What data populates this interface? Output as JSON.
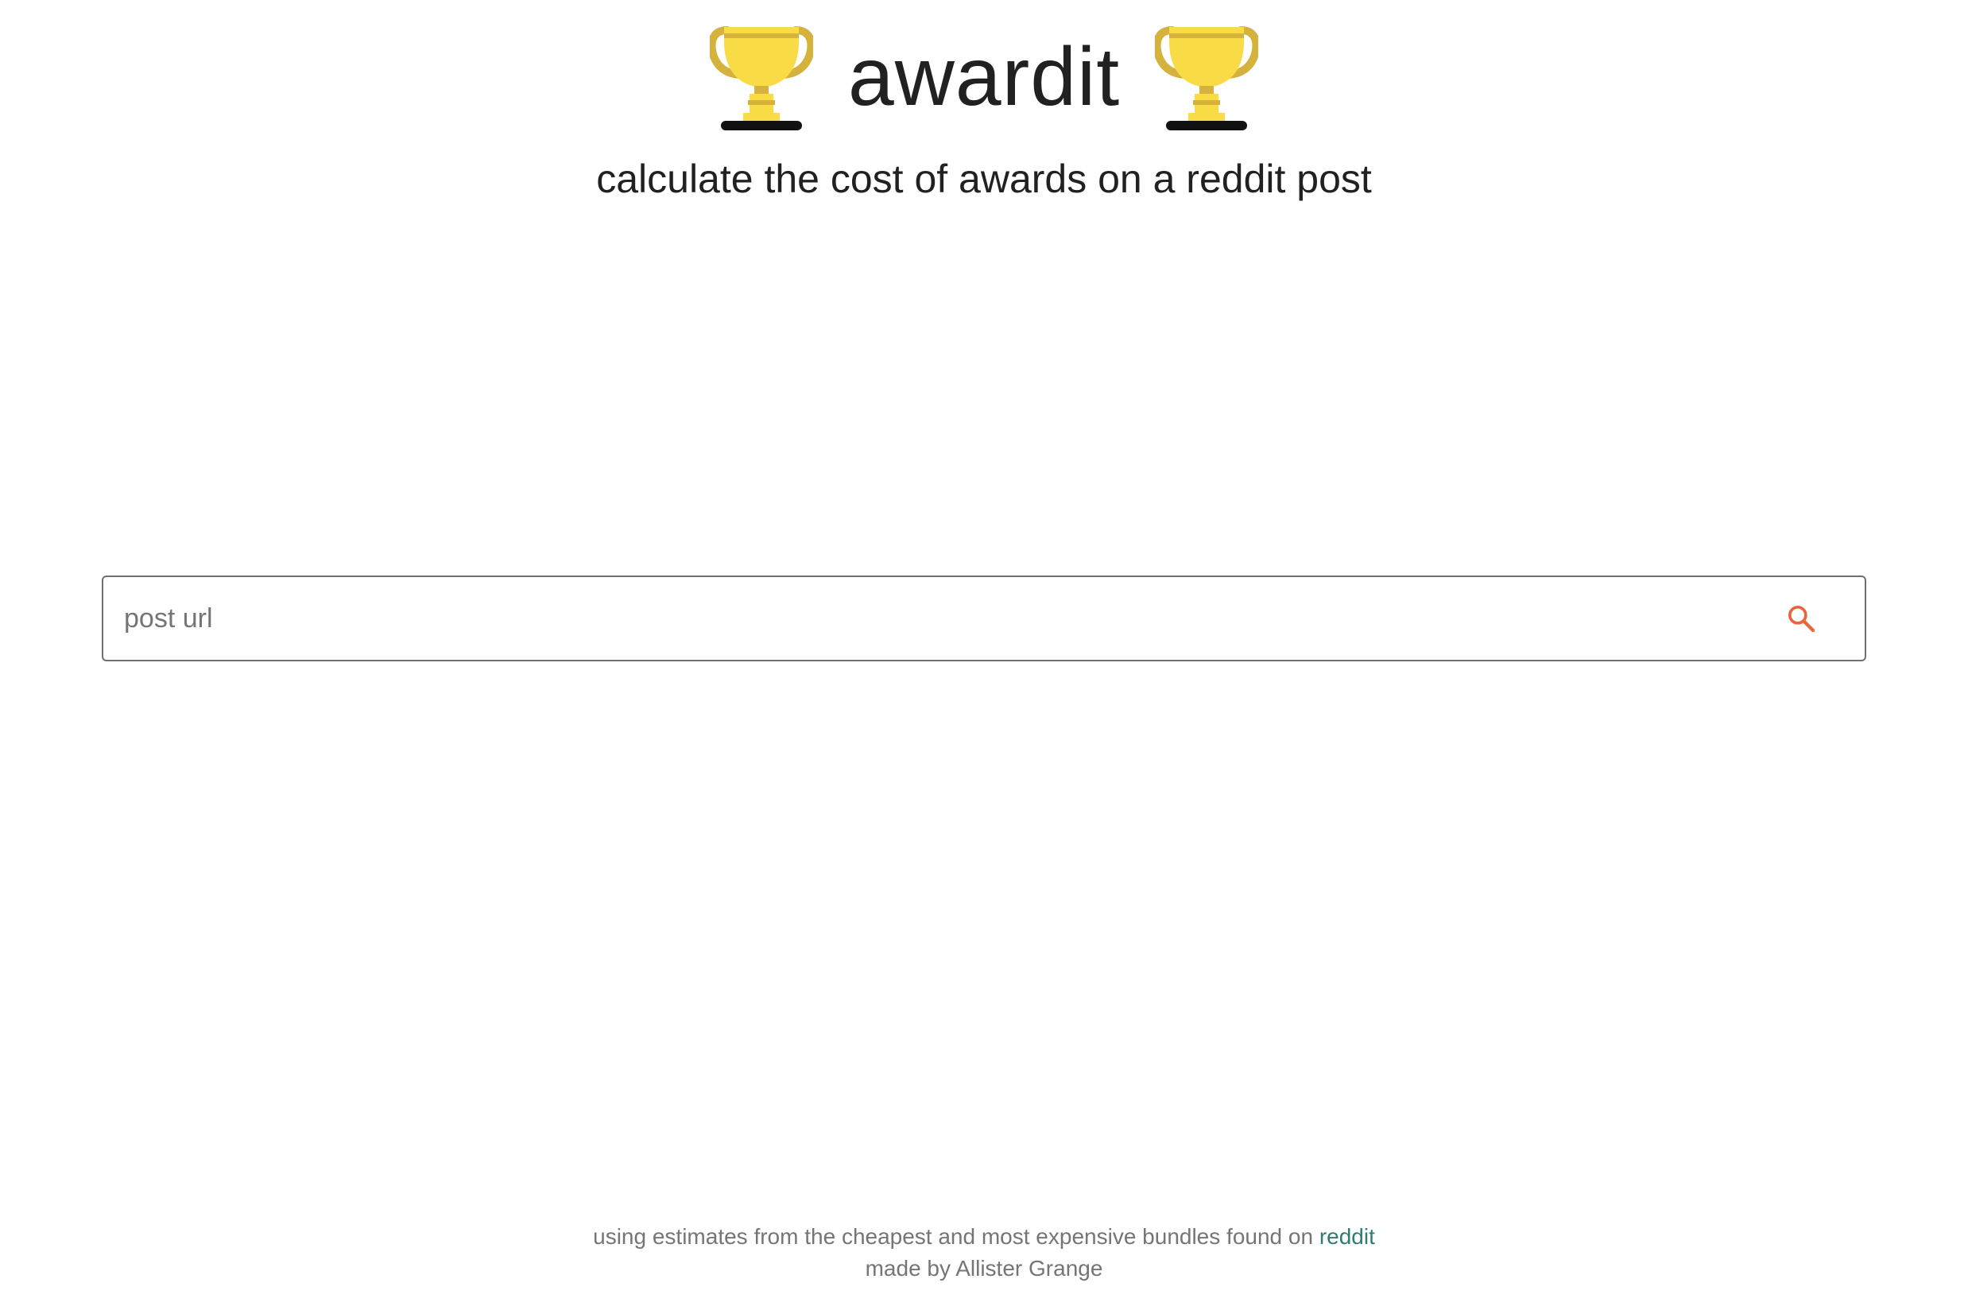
{
  "header": {
    "title": "awardit",
    "left_icon": "trophy-icon",
    "right_icon": "trophy-icon",
    "subtitle": "calculate the cost of awards on a reddit post"
  },
  "search": {
    "placeholder": "post url",
    "value": "",
    "button_icon": "search-icon"
  },
  "footer": {
    "estimate_text": "using estimates from the cheapest and most expensive bundles found on",
    "estimate_link_label": "reddit",
    "credit": "made by Allister Grange"
  },
  "colors": {
    "trophy_gold": "#F9DB46",
    "trophy_shade": "#D4B23C",
    "trophy_base": "#111111",
    "search_icon": "#E8663C",
    "link": "#2E7D73",
    "text": "#212121",
    "muted_text": "#757575"
  }
}
